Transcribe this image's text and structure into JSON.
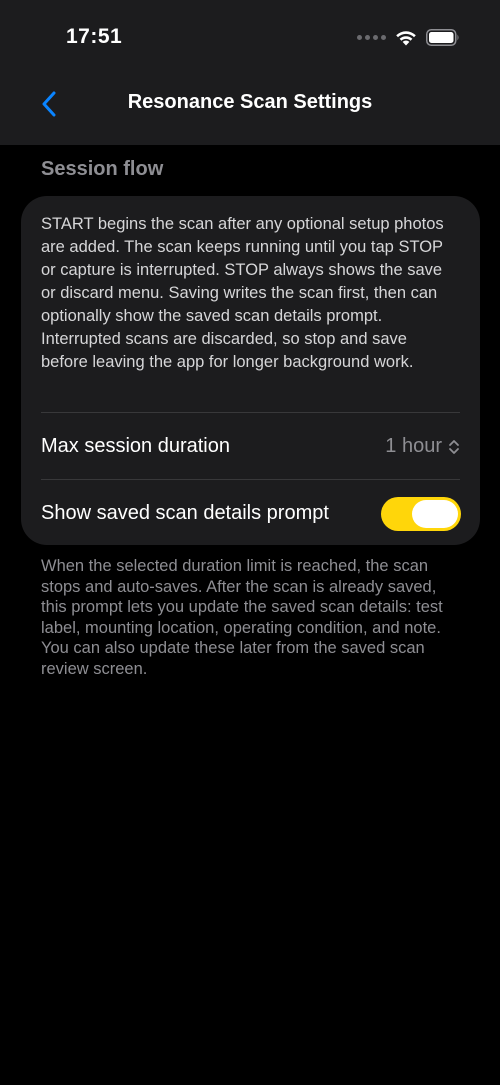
{
  "status_bar": {
    "time": "17:51",
    "icons": [
      "cellular-signal-icon",
      "wifi-icon",
      "battery-icon"
    ]
  },
  "nav": {
    "back_icon": "chevron-left-icon",
    "title": "Resonance Scan Settings"
  },
  "section": {
    "header": "Session flow",
    "description": "START begins the scan after any optional setup photos are added. The scan keeps running until you tap STOP or capture is interrupted. STOP always shows the save or discard menu. Saving writes the scan first, then can optionally show the saved scan details prompt. Interrupted scans are discarded, so stop and save before leaving the app for longer background work.",
    "max_duration": {
      "label": "Max session duration",
      "value": "1 hour"
    },
    "details_prompt": {
      "label": "Show saved scan details prompt",
      "enabled": true
    },
    "footer": "When the selected duration limit is reached, the scan stops and auto-saves. After the scan is already saved, this prompt lets you update the saved scan details: test label, mounting location, operating condition, and note. You can also update these later from the saved scan review screen."
  },
  "colors": {
    "accent": "#0a84ff",
    "toggle_on": "#ffd60a",
    "background": "#000000",
    "card": "#1c1c1e",
    "secondary_text": "#8e8e93"
  }
}
